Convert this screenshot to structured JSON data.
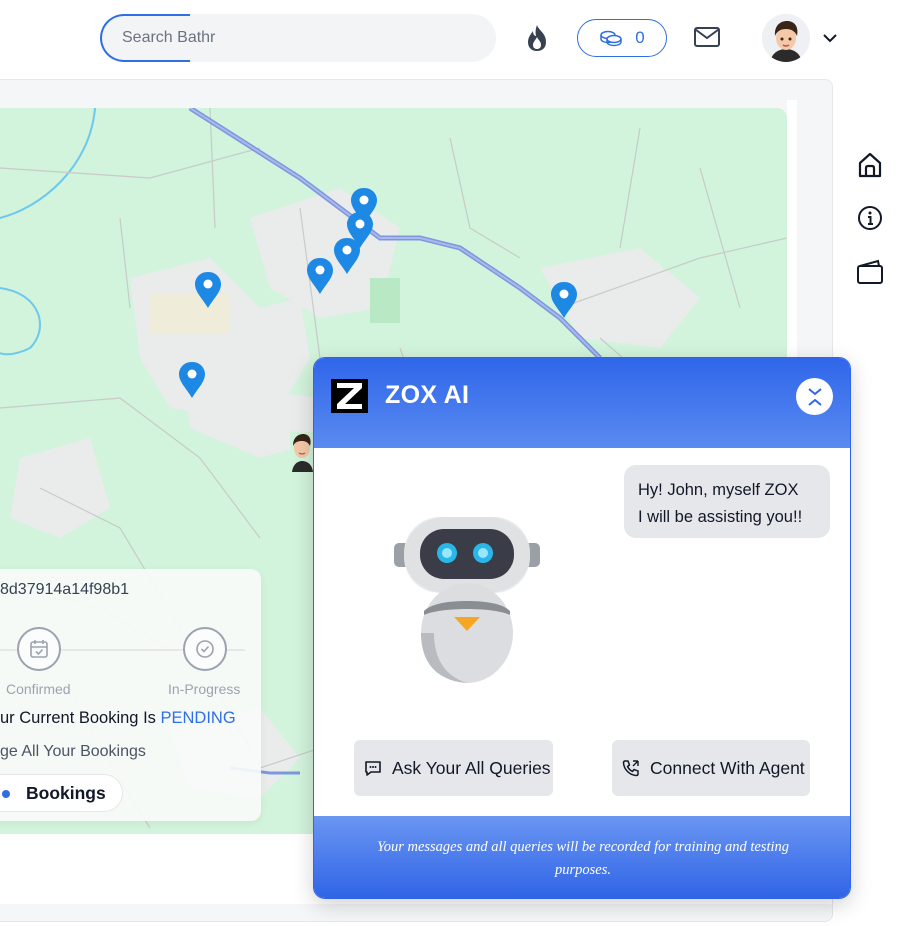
{
  "header": {
    "search_placeholder": "Search Bathr",
    "coins_count": "0",
    "icons": [
      "flame-icon",
      "coins-icon",
      "mail-icon",
      "avatar",
      "chevron-down-icon"
    ]
  },
  "side_nav": {
    "icons": [
      "home-icon",
      "info-icon",
      "wallet-icon"
    ]
  },
  "booking_card": {
    "booking_id": "8d37914a14f98b1",
    "steps": [
      {
        "label": "Confirmed"
      },
      {
        "label": "In-Progress"
      }
    ],
    "status_prefix": "ur Current Booking Is ",
    "status_value": "PENDING",
    "manage_text": "ge All Your Bookings",
    "button_label": "Bookings"
  },
  "chat": {
    "title": "ZOX AI",
    "greeting_line1": "Hy! John, myself ZOX",
    "greeting_line2": "I will be assisting you!!",
    "ask_button": "Ask Your All Queries",
    "agent_button": "Connect With Agent",
    "footer_text": "Your messages and all queries will be recorded for training and testing purposes."
  },
  "colors": {
    "accent": "#2f6fe4",
    "map_green": "#d2f3dc",
    "pin_blue": "#1e88e5"
  }
}
